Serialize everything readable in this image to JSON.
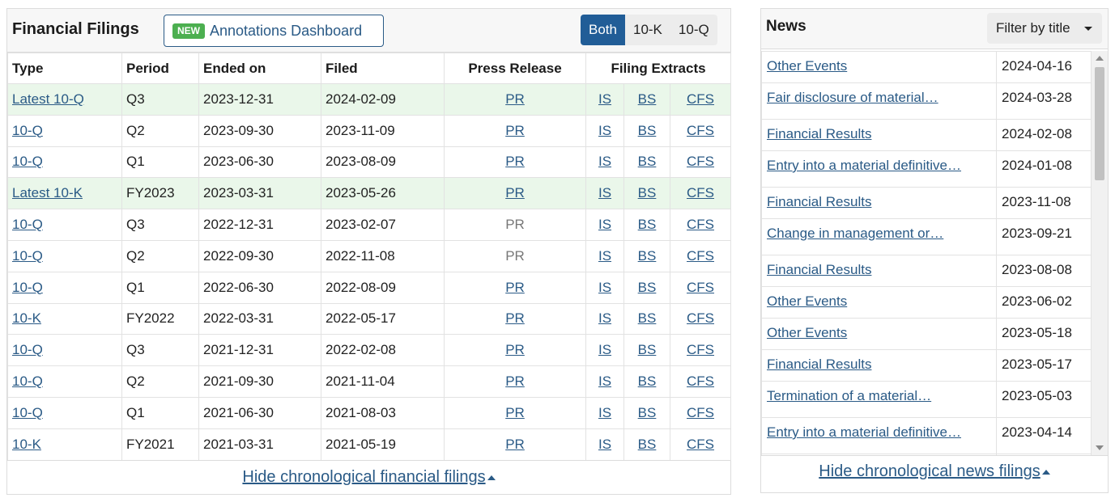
{
  "filings": {
    "title": "Financial Filings",
    "annotations": {
      "badge": "NEW",
      "label": "Annotations Dashboard"
    },
    "toggle": [
      "Both",
      "10-K",
      "10-Q"
    ],
    "columns": {
      "type": "Type",
      "period": "Period",
      "ended": "Ended on",
      "filed": "Filed",
      "press": "Press Release",
      "extracts": "Filing Extracts"
    },
    "rows": [
      {
        "type": "Latest 10-Q",
        "period": "Q3",
        "ended": "2023-12-31",
        "filed": "2024-02-09",
        "pr": "PR",
        "pr_link": true,
        "is": "IS",
        "bs": "BS",
        "cfs": "CFS",
        "highlight": true
      },
      {
        "type": "10-Q",
        "period": "Q2",
        "ended": "2023-09-30",
        "filed": "2023-11-09",
        "pr": "PR",
        "pr_link": true,
        "is": "IS",
        "bs": "BS",
        "cfs": "CFS",
        "highlight": false
      },
      {
        "type": "10-Q",
        "period": "Q1",
        "ended": "2023-06-30",
        "filed": "2023-08-09",
        "pr": "PR",
        "pr_link": true,
        "is": "IS",
        "bs": "BS",
        "cfs": "CFS",
        "highlight": false
      },
      {
        "type": "Latest 10-K",
        "period": "FY2023",
        "ended": "2023-03-31",
        "filed": "2023-05-26",
        "pr": "PR",
        "pr_link": true,
        "is": "IS",
        "bs": "BS",
        "cfs": "CFS",
        "highlight": true
      },
      {
        "type": "10-Q",
        "period": "Q3",
        "ended": "2022-12-31",
        "filed": "2023-02-07",
        "pr": "PR",
        "pr_link": false,
        "is": "IS",
        "bs": "BS",
        "cfs": "CFS",
        "highlight": false
      },
      {
        "type": "10-Q",
        "period": "Q2",
        "ended": "2022-09-30",
        "filed": "2022-11-08",
        "pr": "PR",
        "pr_link": false,
        "is": "IS",
        "bs": "BS",
        "cfs": "CFS",
        "highlight": false
      },
      {
        "type": "10-Q",
        "period": "Q1",
        "ended": "2022-06-30",
        "filed": "2022-08-09",
        "pr": "PR",
        "pr_link": true,
        "is": "IS",
        "bs": "BS",
        "cfs": "CFS",
        "highlight": false
      },
      {
        "type": "10-K",
        "period": "FY2022",
        "ended": "2022-03-31",
        "filed": "2022-05-17",
        "pr": "PR",
        "pr_link": true,
        "is": "IS",
        "bs": "BS",
        "cfs": "CFS",
        "highlight": false
      },
      {
        "type": "10-Q",
        "period": "Q3",
        "ended": "2021-12-31",
        "filed": "2022-02-08",
        "pr": "PR",
        "pr_link": true,
        "is": "IS",
        "bs": "BS",
        "cfs": "CFS",
        "highlight": false
      },
      {
        "type": "10-Q",
        "period": "Q2",
        "ended": "2021-09-30",
        "filed": "2021-11-04",
        "pr": "PR",
        "pr_link": true,
        "is": "IS",
        "bs": "BS",
        "cfs": "CFS",
        "highlight": false
      },
      {
        "type": "10-Q",
        "period": "Q1",
        "ended": "2021-06-30",
        "filed": "2021-08-03",
        "pr": "PR",
        "pr_link": true,
        "is": "IS",
        "bs": "BS",
        "cfs": "CFS",
        "highlight": false
      },
      {
        "type": "10-K",
        "period": "FY2021",
        "ended": "2021-03-31",
        "filed": "2021-05-19",
        "pr": "PR",
        "pr_link": true,
        "is": "IS",
        "bs": "BS",
        "cfs": "CFS",
        "highlight": false
      }
    ],
    "footer": "Hide chronological financial filings"
  },
  "news": {
    "title": "News",
    "filter": "Filter by title",
    "items": [
      {
        "title": "Other Events",
        "date": "2024-04-16"
      },
      {
        "title": "Fair disclosure of material…",
        "date": "2024-03-28"
      },
      {
        "title": "Financial Results",
        "date": "2024-02-08"
      },
      {
        "title": "Entry into a material definitive…",
        "date": "2024-01-08"
      },
      {
        "title": "Financial Results",
        "date": "2023-11-08"
      },
      {
        "title": "Change in management or…",
        "date": "2023-09-21"
      },
      {
        "title": "Financial Results",
        "date": "2023-08-08"
      },
      {
        "title": "Other Events",
        "date": "2023-06-02"
      },
      {
        "title": "Other Events",
        "date": "2023-05-18"
      },
      {
        "title": "Financial Results",
        "date": "2023-05-17"
      },
      {
        "title": "Termination of a material…",
        "date": "2023-05-03"
      },
      {
        "title": "Entry into a material definitive…",
        "date": "2023-04-14"
      },
      {
        "title": "",
        "date": ""
      }
    ],
    "footer": "Hide chronological news filings"
  }
}
